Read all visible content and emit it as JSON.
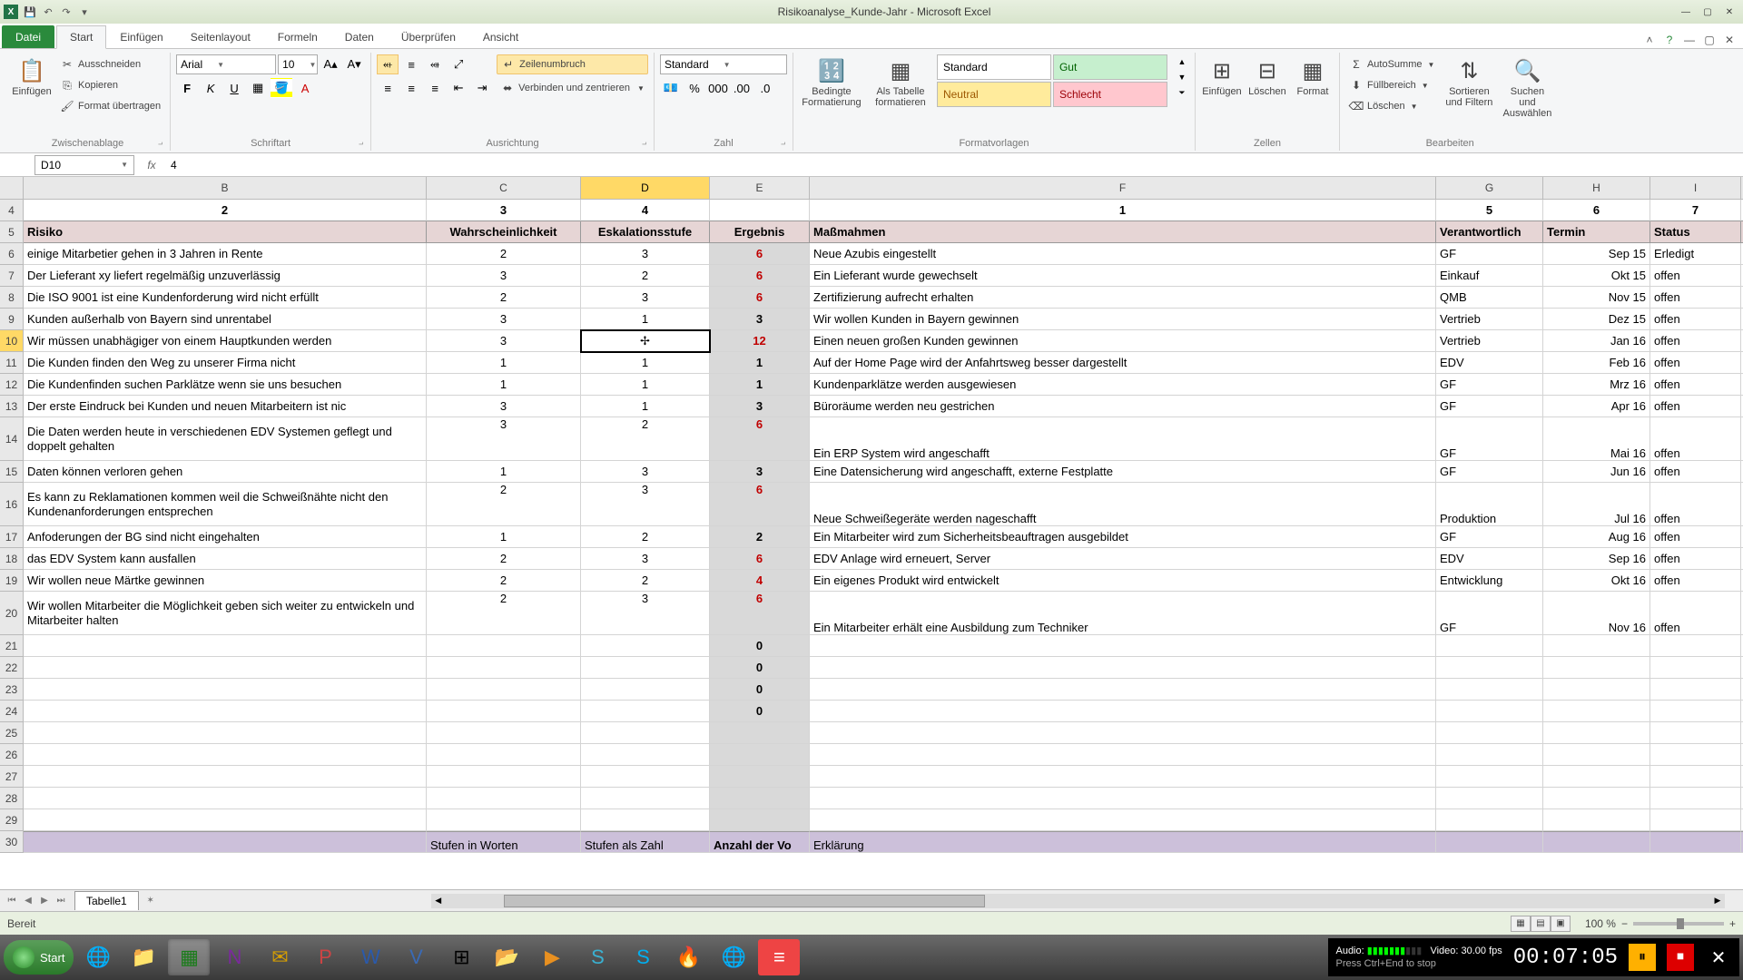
{
  "window": {
    "title": "Risikoanalyse_Kunde-Jahr - Microsoft Excel"
  },
  "qat": {
    "save": "save-icon",
    "undo": "undo-icon",
    "redo": "redo-icon"
  },
  "tabs": {
    "file": "Datei",
    "home": "Start",
    "insert": "Einfügen",
    "layout": "Seitenlayout",
    "formulas": "Formeln",
    "data": "Daten",
    "review": "Überprüfen",
    "view": "Ansicht"
  },
  "ribbon": {
    "clipboard": {
      "label": "Zwischenablage",
      "paste": "Einfügen",
      "cut": "Ausschneiden",
      "copy": "Kopieren",
      "format": "Format übertragen"
    },
    "font": {
      "label": "Schriftart",
      "name": "Arial",
      "size": "10"
    },
    "alignment": {
      "label": "Ausrichtung",
      "wrap": "Zeilenumbruch",
      "merge": "Verbinden und zentrieren"
    },
    "number": {
      "label": "Zahl",
      "format": "Standard"
    },
    "styles": {
      "label": "Formatvorlagen",
      "cond": "Bedingte Formatierung",
      "table": "Als Tabelle formatieren",
      "standard": "Standard",
      "gut": "Gut",
      "neutral": "Neutral",
      "schlecht": "Schlecht"
    },
    "cells": {
      "label": "Zellen",
      "insert": "Einfügen",
      "delete": "Löschen",
      "format": "Format"
    },
    "editing": {
      "label": "Bearbeiten",
      "autosum": "AutoSumme",
      "fill": "Füllbereich",
      "clear": "Löschen",
      "sort": "Sortieren und Filtern",
      "find": "Suchen und Auswählen"
    }
  },
  "namebox": "D10",
  "formula_value": "4",
  "columns": [
    "B",
    "C",
    "D",
    "E",
    "F",
    "G",
    "H",
    "I"
  ],
  "row4": {
    "B": "2",
    "C": "3",
    "D": "4",
    "E": "",
    "F": "1",
    "G": "5",
    "H": "6",
    "I": "7"
  },
  "headers": {
    "B": "Risiko",
    "C": "Wahrscheinlichkeit",
    "D": "Eskalationsstufe",
    "E": "Ergebnis",
    "F": "Maßmahmen",
    "G": "Verantwortlich",
    "H": "Termin",
    "I": "Status"
  },
  "rows": [
    {
      "n": 6,
      "B": "einige Mitarbetier gehen in 3 Jahren in Rente",
      "C": "2",
      "D": "3",
      "E": "6",
      "F": "Neue Azubis eingestellt",
      "G": "GF",
      "H": "Sep 15",
      "I": "Erledigt",
      "red": true
    },
    {
      "n": 7,
      "B": "Der Lieferant xy liefert regelmäßig unzuverlässig",
      "C": "3",
      "D": "2",
      "E": "6",
      "F": "Ein Lieferant wurde gewechselt",
      "G": "Einkauf",
      "H": "Okt 15",
      "I": "offen",
      "red": true
    },
    {
      "n": 8,
      "B": "Die ISO 9001 ist eine Kundenforderung wird nicht erfüllt",
      "C": "2",
      "D": "3",
      "E": "6",
      "F": "Zertifizierung aufrecht erhalten",
      "G": "QMB",
      "H": "Nov 15",
      "I": "offen",
      "red": true
    },
    {
      "n": 9,
      "B": "Kunden außerhalb von Bayern sind unrentabel",
      "C": "3",
      "D": "1",
      "E": "3",
      "F": "Wir wollen Kunden in Bayern gewinnen",
      "G": "Vertrieb",
      "H": "Dez 15",
      "I": "offen"
    },
    {
      "n": 10,
      "B": "Wir müssen unabhägiger von einem Hauptkunden werden",
      "C": "3",
      "D": "",
      "E": "12",
      "F": "Einen neuen großen Kunden gewinnen",
      "G": "Vertrieb",
      "H": "Jan 16",
      "I": "offen",
      "red": true,
      "active": true
    },
    {
      "n": 11,
      "B": "Die Kunden finden den Weg zu unserer Firma nicht",
      "C": "1",
      "D": "1",
      "E": "1",
      "F": "Auf der Home Page wird der Anfahrtsweg besser dargestellt",
      "G": "EDV",
      "H": "Feb 16",
      "I": "offen"
    },
    {
      "n": 12,
      "B": "Die Kundenfinden suchen Parklätze wenn sie uns besuchen",
      "C": "1",
      "D": "1",
      "E": "1",
      "F": "Kundenparklätze werden ausgewiesen",
      "G": "GF",
      "H": "Mrz 16",
      "I": "offen"
    },
    {
      "n": 13,
      "B": "Der erste Eindruck bei Kunden und neuen Mitarbeitern ist nic",
      "C": "3",
      "D": "1",
      "E": "3",
      "F": "Büroräume werden neu gestrichen",
      "G": "GF",
      "H": "Apr 16",
      "I": "offen"
    },
    {
      "n": 14,
      "tall": true,
      "B": "Die Daten werden heute in verschiedenen EDV Systemen geflegt und doppelt gehalten",
      "C": "3",
      "D": "2",
      "E": "6",
      "F": "Ein ERP System wird angeschafft",
      "G": "GF",
      "H": "Mai 16",
      "I": "offen",
      "red": true
    },
    {
      "n": 15,
      "B": "Daten können verloren gehen",
      "C": "1",
      "D": "3",
      "E": "3",
      "F": "Eine Datensicherung wird angeschafft, externe Festplatte",
      "G": "GF",
      "H": "Jun 16",
      "I": "offen"
    },
    {
      "n": 16,
      "tall": true,
      "B": "Es kann zu Reklamationen kommen weil die Schweißnähte nicht den Kundenanforderungen entsprechen",
      "C": "2",
      "D": "3",
      "E": "6",
      "F": "Neue Schweißegeräte werden nageschafft",
      "G": "Produktion",
      "H": "Jul 16",
      "I": "offen",
      "red": true
    },
    {
      "n": 17,
      "B": "Anfoderungen der BG sind nicht eingehalten",
      "C": "1",
      "D": "2",
      "E": "2",
      "F": "Ein Mitarbeiter wird zum Sicherheitsbeauftragen ausgebildet",
      "G": "GF",
      "H": "Aug 16",
      "I": "offen"
    },
    {
      "n": 18,
      "B": "das EDV System kann ausfallen",
      "C": "2",
      "D": "3",
      "E": "6",
      "F": "EDV Anlage wird erneuert, Server",
      "G": "EDV",
      "H": "Sep 16",
      "I": "offen",
      "red": true
    },
    {
      "n": 19,
      "B": "Wir wollen neue Märtke gewinnen",
      "C": "2",
      "D": "2",
      "E": "4",
      "F": "Ein eigenes Produkt wird entwickelt",
      "G": "Entwicklung",
      "H": "Okt 16",
      "I": "offen",
      "red": true
    },
    {
      "n": 20,
      "tall": true,
      "B": "Wir wollen Mitarbeiter die Möglichkeit geben sich weiter zu entwickeln und Mitarbeiter halten",
      "C": "2",
      "D": "3",
      "E": "6",
      "F": "Ein Mitarbeiter erhält eine Ausbildung zum Techniker",
      "G": "GF",
      "H": "Nov 16",
      "I": "offen",
      "red": true
    }
  ],
  "empty_rows": [
    {
      "n": 21,
      "E": "0"
    },
    {
      "n": 22,
      "E": "0"
    },
    {
      "n": 23,
      "E": "0"
    },
    {
      "n": 24,
      "E": "0"
    },
    {
      "n": 25
    },
    {
      "n": 26
    },
    {
      "n": 27
    },
    {
      "n": 28
    },
    {
      "n": 29
    }
  ],
  "footer_row": {
    "n": 30,
    "C": "Stufen in Worten",
    "D": "Stufen als Zahl",
    "E": "Anzahl der Vo",
    "F": "Erklärung"
  },
  "sheet": {
    "name": "Tabelle1"
  },
  "status": {
    "ready": "Bereit",
    "zoom": "100 %"
  },
  "recorder": {
    "audio_label": "Audio:",
    "video_label": "Video: 30.00 fps",
    "hint": "Press Ctrl+End to stop",
    "time": "00:07:05"
  },
  "taskbar": {
    "start": "Start"
  }
}
